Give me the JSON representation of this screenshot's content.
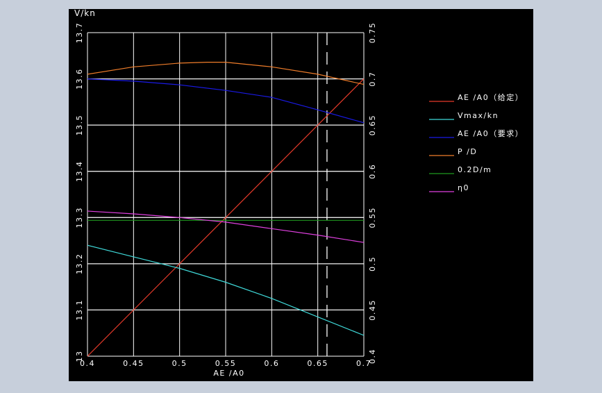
{
  "colors": {
    "window_bg": "#c7cfdb",
    "plot_bg": "#000000",
    "grid": "#ffffff",
    "text": "#ffffff"
  },
  "chart_data": {
    "type": "line",
    "left_axis_label": "V/kn",
    "xlabel": "AE /A0",
    "xlim": [
      0.4,
      0.7
    ],
    "ylim_left": [
      13.0,
      13.7
    ],
    "ylim_right": [
      0.4,
      0.75
    ],
    "x_ticks": [
      "0.4",
      "0.45",
      "0.5",
      "0.55",
      "0.6",
      "0.65",
      "0.7"
    ],
    "left_ticks": [
      "13",
      "13.1",
      "13.2",
      "13.3",
      "13.4",
      "13.5",
      "13.6",
      "13.7"
    ],
    "right_ticks": [
      "0.4",
      "0.45",
      "0.5",
      "0.55",
      "0.6",
      "0.65",
      "0.7",
      "0.75"
    ],
    "grid": true,
    "vertical_marker": {
      "x": 0.66,
      "style": "dashed"
    },
    "legend_position": "right",
    "series": [
      {
        "name": "AE /A0（给定）",
        "color": "#e53a2a",
        "axis": "right",
        "x": [
          0.4,
          0.7
        ],
        "y": [
          0.4,
          0.7
        ]
      },
      {
        "name": "Vmax/kn",
        "color": "#3fd9d9",
        "axis": "left",
        "x": [
          0.4,
          0.45,
          0.5,
          0.55,
          0.6,
          0.65,
          0.7
        ],
        "y": [
          13.24,
          13.215,
          13.19,
          13.16,
          13.125,
          13.085,
          13.045
        ]
      },
      {
        "name": "AE /A0（要求）",
        "color": "#1a1ae6",
        "axis": "left",
        "x": [
          0.4,
          0.45,
          0.5,
          0.55,
          0.6,
          0.65,
          0.7
        ],
        "y": [
          13.6,
          13.595,
          13.587,
          13.575,
          13.56,
          13.533,
          13.505
        ]
      },
      {
        "name": "P /D",
        "color": "#f07d2a",
        "axis": "right",
        "x": [
          0.4,
          0.45,
          0.5,
          0.53,
          0.55,
          0.6,
          0.65,
          0.7
        ],
        "y": [
          0.705,
          0.713,
          0.717,
          0.718,
          0.718,
          0.713,
          0.705,
          0.694
        ]
      },
      {
        "name": "0.2D/m",
        "color": "#1f9a1f",
        "axis": "right",
        "x": [
          0.4,
          0.7
        ],
        "y": [
          0.547,
          0.547
        ]
      },
      {
        "name": "η0",
        "color": "#e040e0",
        "axis": "right",
        "x": [
          0.4,
          0.45,
          0.5,
          0.55,
          0.6,
          0.65,
          0.7
        ],
        "y": [
          0.557,
          0.554,
          0.55,
          0.545,
          0.538,
          0.531,
          0.523
        ]
      }
    ]
  }
}
